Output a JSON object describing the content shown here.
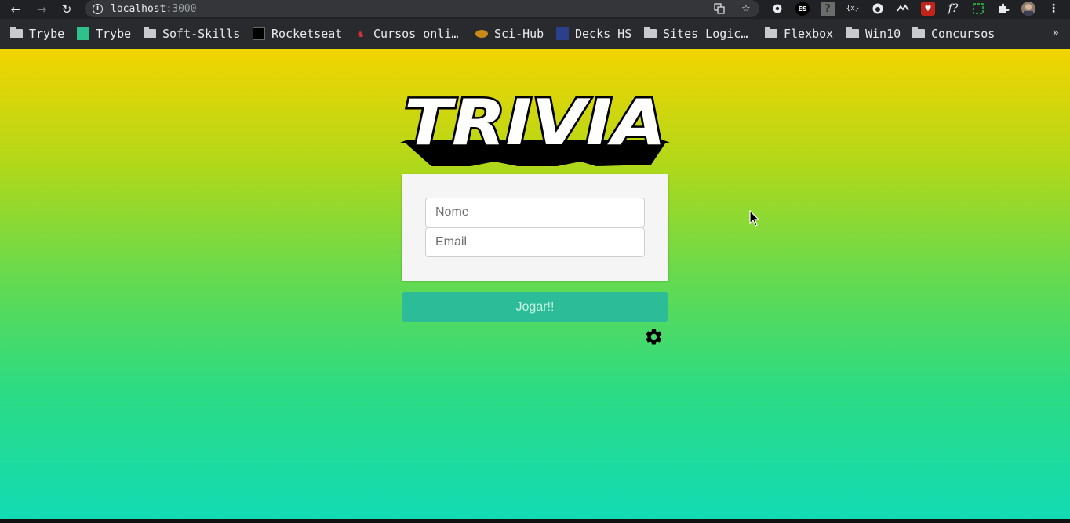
{
  "browser": {
    "url_host": "localhost",
    "url_port": ":3000",
    "icons": {
      "back": "arrow-back-icon",
      "forward": "arrow-forward-icon",
      "reload": "reload-icon",
      "info": "info-icon",
      "translate": "translate-icon",
      "bookmark_star": "star-icon"
    },
    "extensions": [
      "gear-icon",
      "es-badge-icon",
      "help-icon",
      "brackets-icon",
      "github-icon",
      "wave-icon",
      "hearts-icon",
      "formula-icon",
      "selection-icon",
      "puzzle-icon",
      "avatar"
    ],
    "extension_texts": {
      "es": "ES",
      "help": "?",
      "brackets": "{x}",
      "formula": "f?"
    },
    "menu_icon": "kebab-menu-icon"
  },
  "bookmarks": {
    "items": [
      {
        "label": "Trybe",
        "icon": "folder-icon"
      },
      {
        "label": "Trybe",
        "icon": "trybe-favicon"
      },
      {
        "label": "Soft-Skills",
        "icon": "folder-icon"
      },
      {
        "label": "Rocketseat",
        "icon": "rocketseat-favicon"
      },
      {
        "label": "Cursos onli…",
        "icon": "cursos-favicon"
      },
      {
        "label": "Sci-Hub",
        "icon": "scihub-favicon"
      },
      {
        "label": "Decks HS",
        "icon": "decks-favicon"
      },
      {
        "label": "Sites Logic…",
        "icon": "folder-icon"
      },
      {
        "label": "Flexbox",
        "icon": "folder-icon"
      },
      {
        "label": "Win10",
        "icon": "folder-icon"
      },
      {
        "label": "Concursos",
        "icon": "folder-icon"
      }
    ],
    "overflow": "»"
  },
  "login": {
    "logo_text": "TRIVIA",
    "name_placeholder": "Nome",
    "email_placeholder": "Email",
    "play_label": "Jogar!!",
    "settings_icon": "gear-icon"
  },
  "colors": {
    "gradient_top": "#f3d400",
    "gradient_bottom": "#12dbb4",
    "button": "#2cbd98",
    "card": "#f5f5f5"
  }
}
